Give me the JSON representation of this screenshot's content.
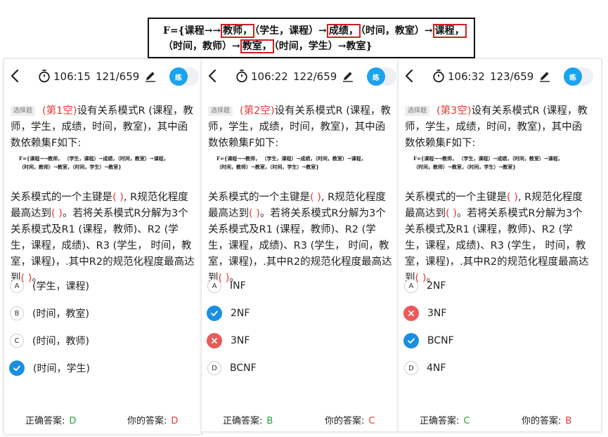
{
  "fd_header": {
    "line1": [
      "F={课程→→",
      "教师，",
      "（学生，课程）→",
      "成绩，",
      "（时间，教室）→",
      "课程，"
    ],
    "line2": [
      "（时间，教师）→",
      "教室，",
      "（时间，学生）→教室}"
    ]
  },
  "question_tag": "选择题",
  "question_text_1": "设有关系模式R (课程，教师，学生，成绩，时间，教室)，其中函数依赖集F如下:",
  "question_text_2_a": "关系模式的一个主键是",
  "blank": "( )",
  "question_text_2_b": ", R规范化程度最高达到",
  "question_text_2_c": "。若将关系模式R分解为3个关系模式及R1 (课程，教师)、R2 (学生，课程，成绩)、R3 (学生， 时间，教室，课程)，.其中R2的规范化程度最高达到",
  "question_text_2_d": "。",
  "fd_small": {
    "line1": "F={课程→→教师，  （学生，课程）→成绩，（时间，教室）→课程，",
    "line2": "（时间，教师）→教室，（时间，学生）→教室}"
  },
  "toggle_label": "练",
  "footer": {
    "correct_label": "正确答案:",
    "yours_label": "你的答案:"
  },
  "panels": [
    {
      "time": "106:15",
      "count": "121/659",
      "blank_label": "(第1空)",
      "options": [
        {
          "letter": "A",
          "text": "(学生，课程)",
          "state": "none"
        },
        {
          "letter": "B",
          "text": "(时间，教室)",
          "state": "none"
        },
        {
          "letter": "C",
          "text": "(时间，教师)",
          "state": "none"
        },
        {
          "letter": "D",
          "text": "(时间，学生)",
          "state": "correct"
        }
      ],
      "correct": "D",
      "yours": "D"
    },
    {
      "time": "106:22",
      "count": "122/659",
      "blank_label": "(第2空)",
      "options": [
        {
          "letter": "A",
          "text": "INF",
          "state": "none"
        },
        {
          "letter": "B",
          "text": "2NF",
          "state": "correct"
        },
        {
          "letter": "C",
          "text": "3NF",
          "state": "wrong"
        },
        {
          "letter": "D",
          "text": "BCNF",
          "state": "none"
        }
      ],
      "correct": "B",
      "yours": "C"
    },
    {
      "time": "106:32",
      "count": "123/659",
      "blank_label": "(第3空)",
      "options": [
        {
          "letter": "A",
          "text": "2NF",
          "state": "none"
        },
        {
          "letter": "B",
          "text": "3NF",
          "state": "wrong"
        },
        {
          "letter": "C",
          "text": "BCNF",
          "state": "correct"
        },
        {
          "letter": "D",
          "text": "4NF",
          "state": "none"
        }
      ],
      "correct": "C",
      "yours": "B"
    }
  ],
  "colors": {
    "accent": "#1a8fe0",
    "wrong": "#ea5a5a",
    "green": "#27a03c",
    "red": "#e53935"
  }
}
